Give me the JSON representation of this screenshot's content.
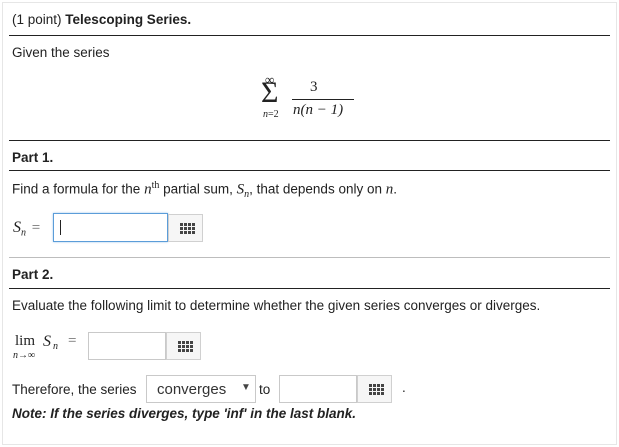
{
  "header": {
    "points": "(1 point)",
    "title": "Telescoping Series."
  },
  "intro": {
    "text": "Given the series"
  },
  "series": {
    "sum_upper": "∞",
    "sum_lower_var": "n",
    "sum_lower_eq": "=2",
    "numerator": "3",
    "denominator": "n(n − 1)"
  },
  "part1": {
    "heading": "Part 1.",
    "prompt_a": "Find a formula for the ",
    "prompt_n": "n",
    "prompt_th": "th",
    "prompt_b": " partial sum, ",
    "prompt_S": "S",
    "prompt_Ssub": "n",
    "prompt_c": ", that depends only on ",
    "prompt_n2": "n",
    "prompt_d": ".",
    "label_S": "S",
    "label_sub": "n",
    "label_eq": "=",
    "answer_value": ""
  },
  "part2": {
    "heading": "Part 2.",
    "prompt": "Evaluate the following limit to determine whether the given series converges or diverges.",
    "lim_word": "lim",
    "lim_sub": "n→∞",
    "lim_S": "S",
    "lim_Ssub": "n",
    "lim_eq": "=",
    "answer_value": ""
  },
  "conclusion": {
    "therefore": "Therefore, the series",
    "select_value": "converges",
    "to": "to",
    "answer_value": "",
    "period": ".",
    "note": "Note: If the series diverges, type 'inf' in the last blank."
  },
  "icons": {
    "equation_editor": "grid-icon",
    "dropdown": "caret-down-icon"
  }
}
